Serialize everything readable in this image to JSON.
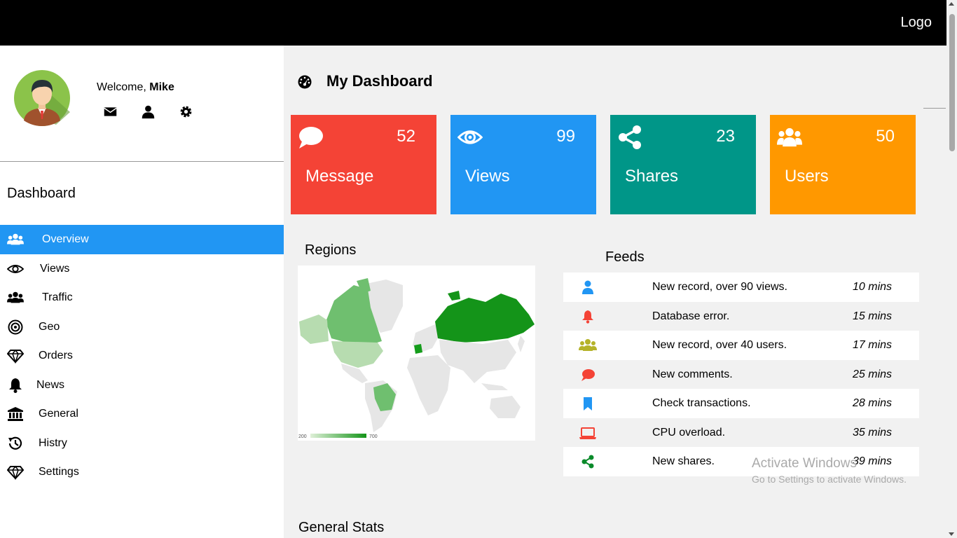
{
  "header": {
    "logo": "Logo"
  },
  "profile": {
    "welcome_prefix": "Welcome, ",
    "user_name": "Mike"
  },
  "sidebar": {
    "heading": "Dashboard",
    "items": [
      {
        "label": "Overview",
        "icon": "users-icon",
        "active": true
      },
      {
        "label": "Views",
        "icon": "eye-icon"
      },
      {
        "label": "Traffic",
        "icon": "users-icon"
      },
      {
        "label": "Geo",
        "icon": "bullseye-icon"
      },
      {
        "label": "Orders",
        "icon": "diamond-icon"
      },
      {
        "label": "News",
        "icon": "bell-icon"
      },
      {
        "label": "General",
        "icon": "bank-icon"
      },
      {
        "label": "Histry",
        "icon": "history-icon"
      },
      {
        "label": "Settings",
        "icon": "diamond-icon"
      }
    ]
  },
  "main": {
    "title": "My Dashboard",
    "cards": [
      {
        "label": "Message",
        "value": "52",
        "color": "#f44336",
        "icon": "comment-icon"
      },
      {
        "label": "Views",
        "value": "99",
        "color": "#2196f3",
        "icon": "eye-icon"
      },
      {
        "label": "Shares",
        "value": "23",
        "color": "#009688",
        "icon": "share-icon"
      },
      {
        "label": "Users",
        "value": "50",
        "color": "#ff9800",
        "icon": "users-icon"
      }
    ],
    "regions": {
      "title": "Regions",
      "legend_min": "200",
      "legend_max": "700"
    },
    "feeds": {
      "title": "Feeds",
      "items": [
        {
          "text": "New record, over 90 views.",
          "time": "10 mins",
          "icon": "user-icon",
          "color": "#2196f3"
        },
        {
          "text": "Database error.",
          "time": "15 mins",
          "icon": "bell-icon",
          "color": "#f44336"
        },
        {
          "text": "New record, over 40 users.",
          "time": "17 mins",
          "icon": "users-icon",
          "color": "#b5b32a"
        },
        {
          "text": "New comments.",
          "time": "25 mins",
          "icon": "comment-icon",
          "color": "#f44336"
        },
        {
          "text": "Check transactions.",
          "time": "28 mins",
          "icon": "bookmark-icon",
          "color": "#2196f3"
        },
        {
          "text": "CPU overload.",
          "time": "35 mins",
          "icon": "laptop-icon",
          "color": "#f44336"
        },
        {
          "text": "New shares.",
          "time": "39 mins",
          "icon": "share-icon",
          "color": "#0a8a2a"
        }
      ]
    },
    "general_stats_title": "General Stats"
  },
  "watermark": {
    "line1": "Activate Windows",
    "line2": "Go to Settings to activate Windows."
  }
}
